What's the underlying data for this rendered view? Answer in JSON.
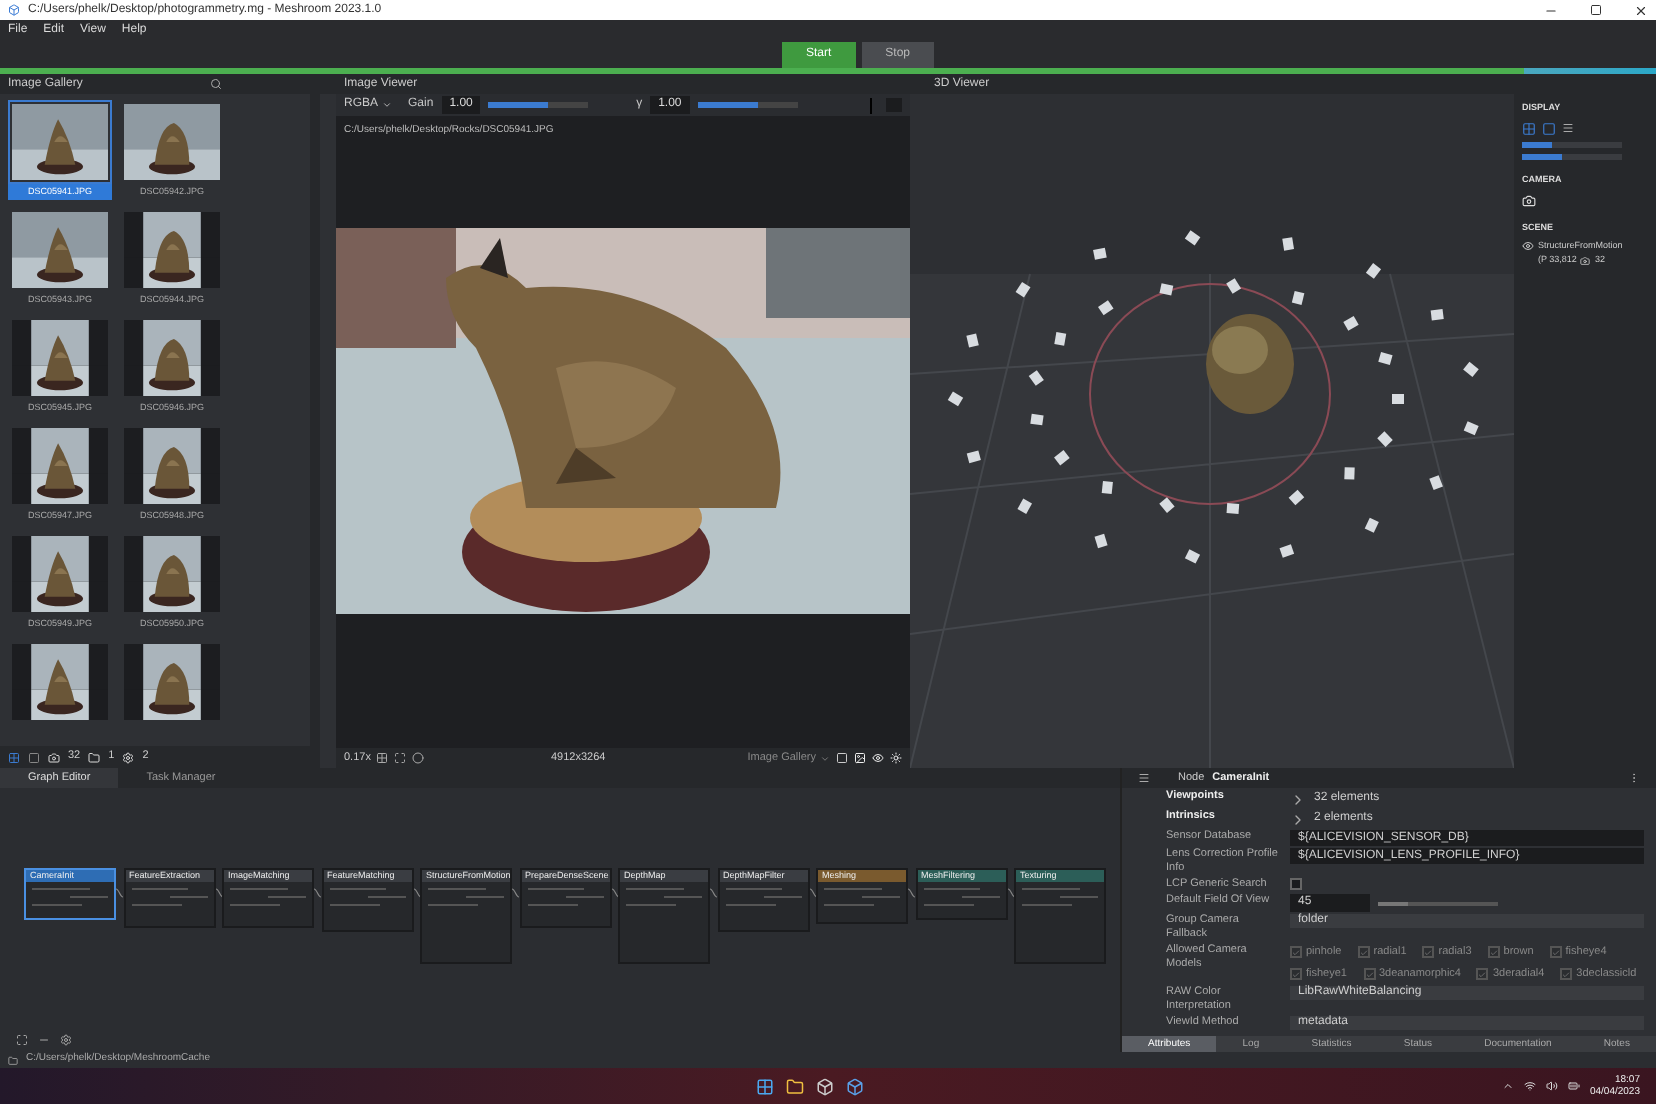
{
  "window": {
    "title": "C:/Users/phelk/Desktop/photogrammetry.mg - Meshroom 2023.1.0"
  },
  "menu": [
    "File",
    "Edit",
    "View",
    "Help"
  ],
  "toolbar": {
    "buttons": [
      {
        "label": "Start",
        "kind": "primary"
      },
      {
        "label": "Stop",
        "kind": "secondary"
      }
    ],
    "progress": {
      "level": 0.92
    }
  },
  "gallery": {
    "title": "Image Gallery",
    "images": [
      {
        "label": "DSC05941.JPG",
        "selected": true
      },
      {
        "label": "DSC05942.JPG",
        "selected": false
      },
      {
        "label": "DSC05943.JPG",
        "selected": false
      },
      {
        "label": "DSC05944.JPG",
        "selected": false
      },
      {
        "label": "DSC05945.JPG",
        "selected": false
      },
      {
        "label": "DSC05946.JPG",
        "selected": false
      },
      {
        "label": "DSC05947.JPG",
        "selected": false
      },
      {
        "label": "DSC05948.JPG",
        "selected": false
      },
      {
        "label": "DSC05949.JPG",
        "selected": false
      },
      {
        "label": "DSC05950.JPG",
        "selected": false
      },
      {
        "selected": false
      },
      {
        "selected": false
      }
    ],
    "counts": [
      "32",
      "1",
      "2"
    ]
  },
  "image_viewer": {
    "title": "Image Viewer",
    "channel": "RGBA",
    "gain": {
      "label": "Gain",
      "value": "1.00",
      "level": 0.6
    },
    "gamma": {
      "label": "γ",
      "value": "1.00",
      "level": 0.6
    },
    "path": "C:/Users/phelk/Desktop/Rocks/DSC05941.JPG",
    "zoom": "0.17x",
    "resolution": "4912x3264",
    "source": "Image Gallery"
  },
  "viewer_3d": {
    "title": "3D Viewer",
    "display_heading": "DISPLAY",
    "point_size": {
      "level": 0.3
    },
    "camera_scale": {
      "level": 0.4
    },
    "camera_heading": "CAMERA",
    "scene_heading": "SCENE",
    "scene_item": {
      "name": "StructureFromMotion",
      "points": "(P 33,812",
      "cameras": "32"
    }
  },
  "graph": {
    "tabs": [
      {
        "label": "Graph Editor",
        "selected": true
      },
      {
        "label": "Task Manager",
        "selected": false
      }
    ],
    "nodes": [
      {
        "title": "CameraInit",
        "selected": true,
        "color": "#2e6db4"
      },
      {
        "title": "FeatureExtraction",
        "selected": false,
        "color": "#3a3d42"
      },
      {
        "title": "ImageMatching",
        "selected": false,
        "color": "#3a3d42"
      },
      {
        "title": "FeatureMatching",
        "selected": false,
        "color": "#3a3d42"
      },
      {
        "title": "StructureFromMotion",
        "selected": false,
        "color": "#3a3d42"
      },
      {
        "title": "PrepareDenseScene",
        "selected": false,
        "color": "#3a3d42"
      },
      {
        "title": "DepthMap",
        "selected": false,
        "color": "#3a3d42"
      },
      {
        "title": "DepthMapFilter",
        "selected": false,
        "color": "#3a3d42"
      },
      {
        "title": "Meshing",
        "selected": false,
        "color": "#7a5a2e"
      },
      {
        "title": "MeshFiltering",
        "selected": false,
        "color": "#2c5e58"
      },
      {
        "title": "Texturing",
        "selected": false,
        "color": "#2c5e58"
      }
    ]
  },
  "attributes": {
    "title": "Node",
    "node": "CameraInit",
    "rows": [
      {
        "label": "Viewpoints",
        "kind": "list",
        "value": "32 elements"
      },
      {
        "label": "Intrinsics",
        "kind": "list",
        "value": "2 elements"
      },
      {
        "label": "Sensor Database",
        "kind": "text",
        "value": "${ALICEVISION_SENSOR_DB}"
      },
      {
        "label": "Lens Correction Profile Info",
        "kind": "text",
        "value": "${ALICEVISION_LENS_PROFILE_INFO}"
      },
      {
        "label": "LCP Generic Search",
        "kind": "checkbox",
        "checked": false
      },
      {
        "label": "Default Field Of View",
        "kind": "slider",
        "value": "45",
        "level": 0.25
      },
      {
        "label": "Group Camera Fallback",
        "kind": "select",
        "value": "folder"
      },
      {
        "label": "Allowed Camera Models",
        "kind": "checkgroup",
        "options": [
          {
            "label": "pinhole",
            "checked": true
          },
          {
            "label": "radial1",
            "checked": true
          },
          {
            "label": "radial3",
            "checked": true
          },
          {
            "label": "brown",
            "checked": true
          },
          {
            "label": "fisheye4",
            "checked": true
          },
          {
            "label": "fisheye1",
            "checked": true
          },
          {
            "label": "3deanamorphic4",
            "checked": true
          },
          {
            "label": "3deradial4",
            "checked": true
          },
          {
            "label": "3declassicld",
            "checked": true
          }
        ]
      },
      {
        "label": "RAW Color Interpretation",
        "kind": "select",
        "value": "LibRawWhiteBalancing"
      },
      {
        "label": "ViewId Method",
        "kind": "select",
        "value": "metadata"
      }
    ],
    "tabs": [
      {
        "label": "Attributes",
        "selected": true
      },
      {
        "label": "Log",
        "selected": false
      },
      {
        "label": "Statistics",
        "selected": false
      },
      {
        "label": "Status",
        "selected": false
      },
      {
        "label": "Documentation",
        "selected": false
      },
      {
        "label": "Notes",
        "selected": false
      }
    ]
  },
  "status_path": "C:/Users/phelk/Desktop/MeshroomCache",
  "taskbar": {
    "time": "18:07",
    "date": "04/04/2023"
  }
}
